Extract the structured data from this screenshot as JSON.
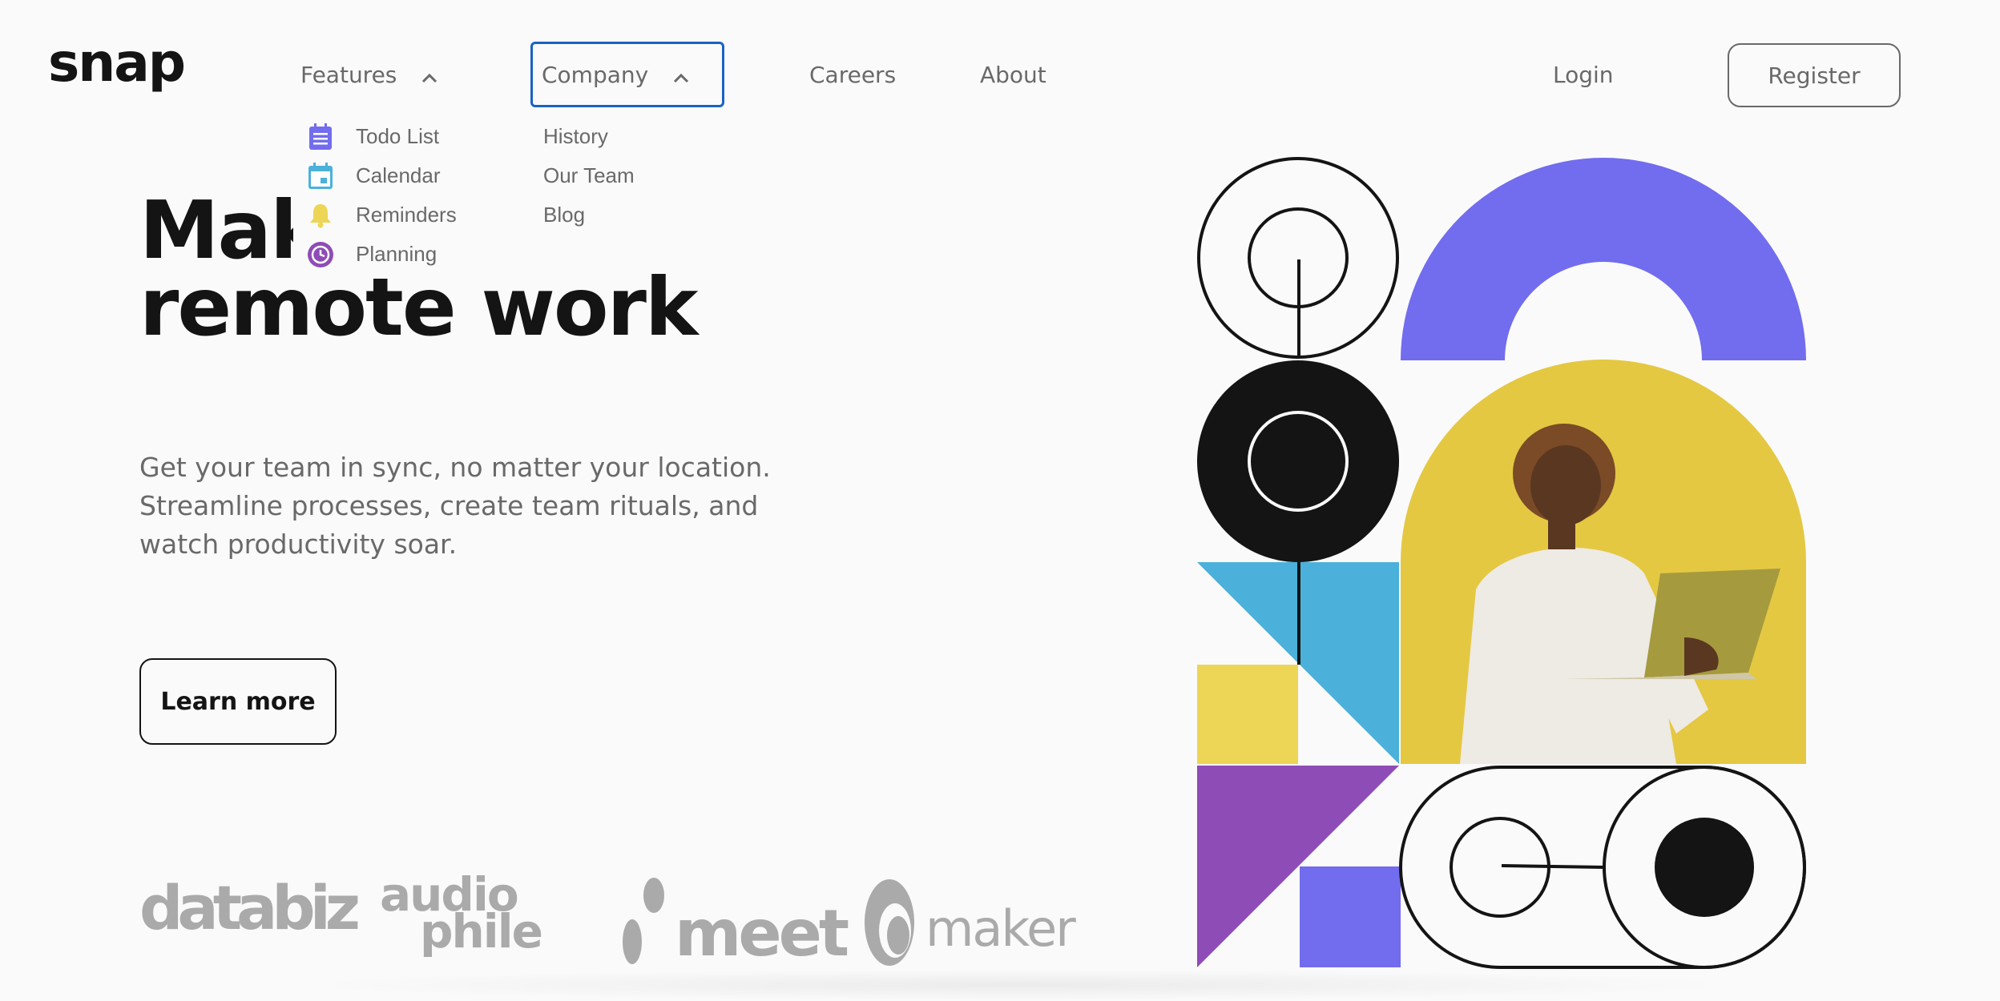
{
  "brand": {
    "logo": "snap"
  },
  "nav": {
    "features": "Features",
    "company": "Company",
    "careers": "Careers",
    "about": "About",
    "login": "Login",
    "register": "Register"
  },
  "features_menu": [
    {
      "label": "Todo List",
      "icon": "todo-list-icon",
      "color": "#726cee"
    },
    {
      "label": "Calendar",
      "icon": "calendar-icon",
      "color": "#4bb1da"
    },
    {
      "label": "Reminders",
      "icon": "bell-icon",
      "color": "#edd556"
    },
    {
      "label": "Planning",
      "icon": "clock-icon",
      "color": "#8e4cb6"
    }
  ],
  "company_menu": [
    {
      "label": "History"
    },
    {
      "label": "Our Team"
    },
    {
      "label": "Blog"
    }
  ],
  "hero": {
    "headline_line1": "Make",
    "headline_line2": "remote work",
    "subtext": "Get your team in sync, no matter your location. Streamline processes, create team rituals, and watch productivity soar.",
    "cta": "Learn more"
  },
  "clients": {
    "databiz": "databiz",
    "audiophile_1": "audio",
    "audiophile_2": "phile",
    "meet": "meet",
    "maker": "maker"
  },
  "colors": {
    "purple": "#726cee",
    "yellow": "#edd556",
    "blue": "#4bb1da",
    "violet": "#8e4cb6",
    "dark": "#141414",
    "gray": "#696969",
    "focus": "#1a62c4"
  }
}
